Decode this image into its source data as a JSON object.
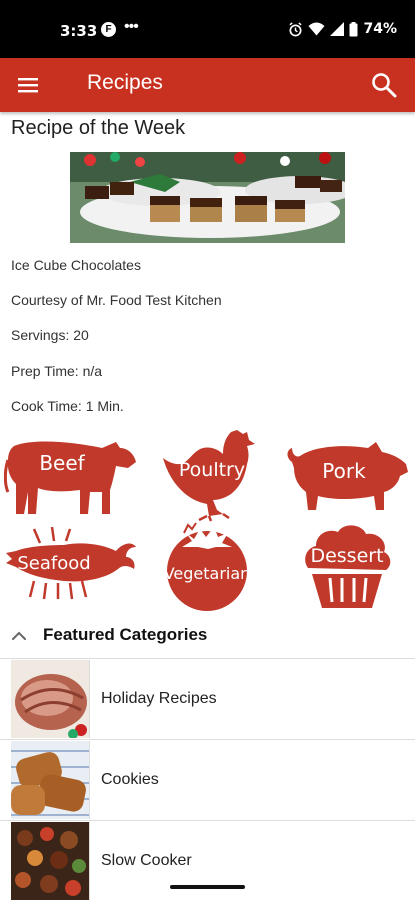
{
  "status_bar": {
    "time": "3:33",
    "app_icon_letter": "F",
    "dots": "•••",
    "battery": "74%"
  },
  "app_bar": {
    "title": "Recipes",
    "menu_icon": "hamburger-menu-icon",
    "search_icon": "search-icon",
    "color": "#c8301f"
  },
  "recipe_of_week": {
    "section_title": "Recipe of the Week",
    "name": "Ice Cube Chocolates",
    "courtesy": "Courtesy of Mr. Food Test Kitchen",
    "servings": "Servings: 20",
    "prep_time": "Prep Time: n/a",
    "cook_time": "Cook Time: 1 Min."
  },
  "categories": [
    {
      "label": "Beef",
      "icon": "cow-icon"
    },
    {
      "label": "Poultry",
      "icon": "chicken-icon"
    },
    {
      "label": "Pork",
      "icon": "pig-icon"
    },
    {
      "label": "Seafood",
      "icon": "lobster-icon"
    },
    {
      "label": "Vegetarian",
      "icon": "tomato-icon"
    },
    {
      "label": "Dessert",
      "icon": "cupcake-icon"
    }
  ],
  "featured": {
    "title": "Featured Categories",
    "items": [
      {
        "label": "Holiday Recipes"
      },
      {
        "label": "Cookies"
      },
      {
        "label": "Slow Cooker"
      }
    ]
  },
  "colors": {
    "accent": "#c8301f",
    "category_fill": "#c0392b"
  }
}
